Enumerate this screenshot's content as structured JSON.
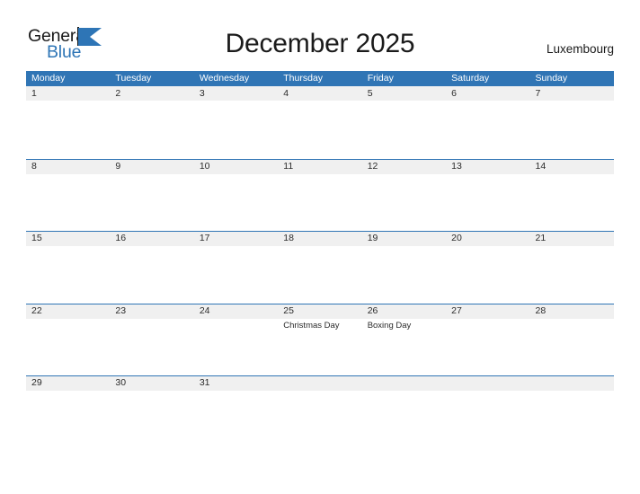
{
  "brand": {
    "name_part1": "General",
    "name_part2": "Blue",
    "triangle_icon": "triangle-icon",
    "color_primary": "#2E75B6",
    "color_text": "#1a1a1a"
  },
  "header": {
    "title": "December 2025",
    "location": "Luxembourg"
  },
  "calendar": {
    "header_color": "#3075B5",
    "band_color": "#f0f0f0",
    "weekday_headers": [
      "Monday",
      "Tuesday",
      "Wednesday",
      "Thursday",
      "Friday",
      "Saturday",
      "Sunday"
    ],
    "weeks": [
      {
        "days": [
          {
            "num": "1",
            "events": []
          },
          {
            "num": "2",
            "events": []
          },
          {
            "num": "3",
            "events": []
          },
          {
            "num": "4",
            "events": []
          },
          {
            "num": "5",
            "events": []
          },
          {
            "num": "6",
            "events": []
          },
          {
            "num": "7",
            "events": []
          }
        ]
      },
      {
        "days": [
          {
            "num": "8",
            "events": []
          },
          {
            "num": "9",
            "events": []
          },
          {
            "num": "10",
            "events": []
          },
          {
            "num": "11",
            "events": []
          },
          {
            "num": "12",
            "events": []
          },
          {
            "num": "13",
            "events": []
          },
          {
            "num": "14",
            "events": []
          }
        ]
      },
      {
        "days": [
          {
            "num": "15",
            "events": []
          },
          {
            "num": "16",
            "events": []
          },
          {
            "num": "17",
            "events": []
          },
          {
            "num": "18",
            "events": []
          },
          {
            "num": "19",
            "events": []
          },
          {
            "num": "20",
            "events": []
          },
          {
            "num": "21",
            "events": []
          }
        ]
      },
      {
        "days": [
          {
            "num": "22",
            "events": []
          },
          {
            "num": "23",
            "events": []
          },
          {
            "num": "24",
            "events": []
          },
          {
            "num": "25",
            "events": [
              "Christmas Day"
            ]
          },
          {
            "num": "26",
            "events": [
              "Boxing Day"
            ]
          },
          {
            "num": "27",
            "events": []
          },
          {
            "num": "28",
            "events": []
          }
        ]
      },
      {
        "days": [
          {
            "num": "29",
            "events": []
          },
          {
            "num": "30",
            "events": []
          },
          {
            "num": "31",
            "events": []
          },
          {
            "num": "",
            "events": []
          },
          {
            "num": "",
            "events": []
          },
          {
            "num": "",
            "events": []
          },
          {
            "num": "",
            "events": []
          }
        ]
      }
    ]
  }
}
